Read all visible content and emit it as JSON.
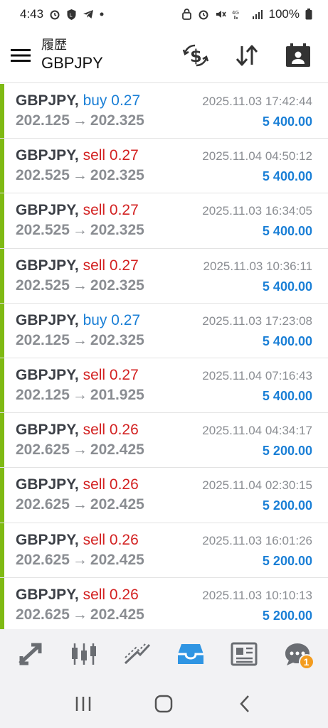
{
  "status_bar": {
    "time": "4:43",
    "battery": "100%",
    "network": "4G"
  },
  "header": {
    "subtitle": "履歴",
    "title": "GBPJPY"
  },
  "rows": [
    {
      "symbol": "GBPJPY,",
      "side": "buy",
      "volume": "0.27",
      "open": "202.125",
      "arrow": "→",
      "close": "202.325",
      "time": "2025.11.03 17:42:44",
      "profit": "5 400.00"
    },
    {
      "symbol": "GBPJPY,",
      "side": "sell",
      "volume": "0.27",
      "open": "202.525",
      "arrow": "→",
      "close": "202.325",
      "time": "2025.11.04 04:50:12",
      "profit": "5 400.00"
    },
    {
      "symbol": "GBPJPY,",
      "side": "sell",
      "volume": "0.27",
      "open": "202.525",
      "arrow": "→",
      "close": "202.325",
      "time": "2025.11.03 16:34:05",
      "profit": "5 400.00"
    },
    {
      "symbol": "GBPJPY,",
      "side": "sell",
      "volume": "0.27",
      "open": "202.525",
      "arrow": "→",
      "close": "202.325",
      "time": "2025.11.03 10:36:11",
      "profit": "5 400.00"
    },
    {
      "symbol": "GBPJPY,",
      "side": "buy",
      "volume": "0.27",
      "open": "202.125",
      "arrow": "→",
      "close": "202.325",
      "time": "2025.11.03 17:23:08",
      "profit": "5 400.00"
    },
    {
      "symbol": "GBPJPY,",
      "side": "sell",
      "volume": "0.27",
      "open": "202.125",
      "arrow": "→",
      "close": "201.925",
      "time": "2025.11.04 07:16:43",
      "profit": "5 400.00"
    },
    {
      "symbol": "GBPJPY,",
      "side": "sell",
      "volume": "0.26",
      "open": "202.625",
      "arrow": "→",
      "close": "202.425",
      "time": "2025.11.04 04:34:17",
      "profit": "5 200.00"
    },
    {
      "symbol": "GBPJPY,",
      "side": "sell",
      "volume": "0.26",
      "open": "202.625",
      "arrow": "→",
      "close": "202.425",
      "time": "2025.11.04 02:30:15",
      "profit": "5 200.00"
    },
    {
      "symbol": "GBPJPY,",
      "side": "sell",
      "volume": "0.26",
      "open": "202.625",
      "arrow": "→",
      "close": "202.425",
      "time": "2025.11.03 16:01:26",
      "profit": "5 200.00"
    },
    {
      "symbol": "GBPJPY,",
      "side": "sell",
      "volume": "0.26",
      "open": "202.625",
      "arrow": "→",
      "close": "202.425",
      "time": "2025.11.03 10:10:13",
      "profit": "5 200.00"
    }
  ],
  "bottom_nav": {
    "items": [
      {
        "icon": "quotes-arrows-icon",
        "active": false
      },
      {
        "icon": "candlestick-chart-icon",
        "active": false
      },
      {
        "icon": "trade-line-icon",
        "active": false
      },
      {
        "icon": "history-inbox-icon",
        "active": true
      },
      {
        "icon": "news-icon",
        "active": false
      },
      {
        "icon": "chat-icon",
        "active": false,
        "badge": "1"
      }
    ]
  },
  "colors": {
    "accent_blue": "#1a7fd6",
    "sell_red": "#d32222",
    "row_bar_green": "#7fba13",
    "badge_orange": "#f39c1f"
  }
}
